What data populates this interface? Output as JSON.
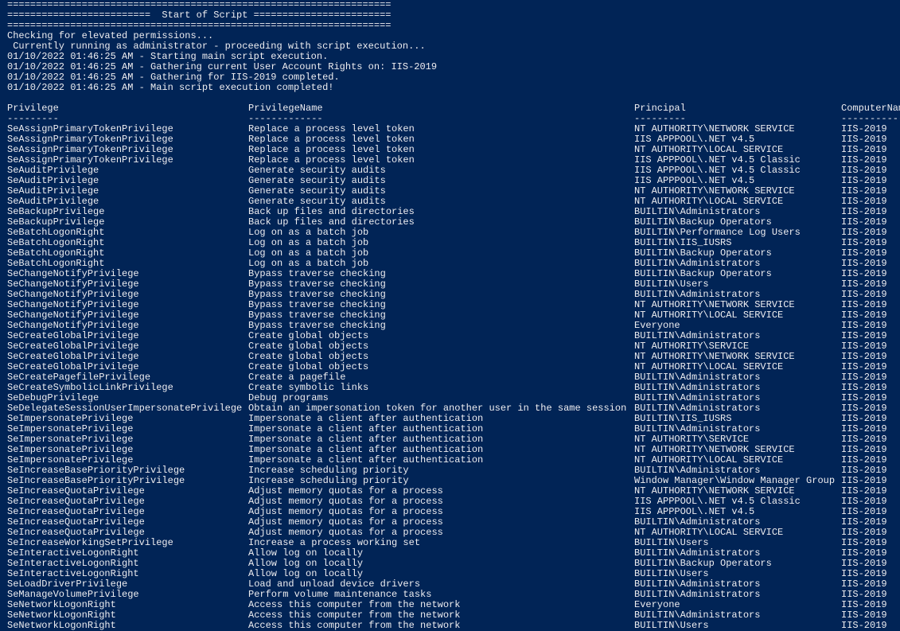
{
  "colors": {
    "background": "#012456",
    "text": "#eeedf0"
  },
  "banner": [
    "===================================================================",
    "=========================  Start of Script ========================",
    "==================================================================="
  ],
  "log": [
    "Checking for elevated permissions...",
    " Currently running as administrator - proceeding with script execution...",
    "01/10/2022 01:46:25 AM - Starting main script execution.",
    "01/10/2022 01:46:25 AM - Gathering current User Account Rights on: IIS-2019",
    "01/10/2022 01:46:25 AM - Gathering for IIS-2019 completed.",
    "01/10/2022 01:46:25 AM - Main script execution completed!"
  ],
  "table": {
    "headers": [
      "Privilege",
      "PrivilegeName",
      "Principal",
      "ComputerName"
    ],
    "underlines": [
      "---------",
      "-------------",
      "---------",
      "------------"
    ],
    "rows": [
      [
        "SeAssignPrimaryTokenPrivilege",
        "Replace a process level token",
        "NT AUTHORITY\\NETWORK SERVICE",
        "IIS-2019"
      ],
      [
        "SeAssignPrimaryTokenPrivilege",
        "Replace a process level token",
        "IIS APPPOOL\\.NET v4.5",
        "IIS-2019"
      ],
      [
        "SeAssignPrimaryTokenPrivilege",
        "Replace a process level token",
        "NT AUTHORITY\\LOCAL SERVICE",
        "IIS-2019"
      ],
      [
        "SeAssignPrimaryTokenPrivilege",
        "Replace a process level token",
        "IIS APPPOOL\\.NET v4.5 Classic",
        "IIS-2019"
      ],
      [
        "SeAuditPrivilege",
        "Generate security audits",
        "IIS APPPOOL\\.NET v4.5 Classic",
        "IIS-2019"
      ],
      [
        "SeAuditPrivilege",
        "Generate security audits",
        "IIS APPPOOL\\.NET v4.5",
        "IIS-2019"
      ],
      [
        "SeAuditPrivilege",
        "Generate security audits",
        "NT AUTHORITY\\NETWORK SERVICE",
        "IIS-2019"
      ],
      [
        "SeAuditPrivilege",
        "Generate security audits",
        "NT AUTHORITY\\LOCAL SERVICE",
        "IIS-2019"
      ],
      [
        "SeBackupPrivilege",
        "Back up files and directories",
        "BUILTIN\\Administrators",
        "IIS-2019"
      ],
      [
        "SeBackupPrivilege",
        "Back up files and directories",
        "BUILTIN\\Backup Operators",
        "IIS-2019"
      ],
      [
        "SeBatchLogonRight",
        "Log on as a batch job",
        "BUILTIN\\Performance Log Users",
        "IIS-2019"
      ],
      [
        "SeBatchLogonRight",
        "Log on as a batch job",
        "BUILTIN\\IIS_IUSRS",
        "IIS-2019"
      ],
      [
        "SeBatchLogonRight",
        "Log on as a batch job",
        "BUILTIN\\Backup Operators",
        "IIS-2019"
      ],
      [
        "SeBatchLogonRight",
        "Log on as a batch job",
        "BUILTIN\\Administrators",
        "IIS-2019"
      ],
      [
        "SeChangeNotifyPrivilege",
        "Bypass traverse checking",
        "BUILTIN\\Backup Operators",
        "IIS-2019"
      ],
      [
        "SeChangeNotifyPrivilege",
        "Bypass traverse checking",
        "BUILTIN\\Users",
        "IIS-2019"
      ],
      [
        "SeChangeNotifyPrivilege",
        "Bypass traverse checking",
        "BUILTIN\\Administrators",
        "IIS-2019"
      ],
      [
        "SeChangeNotifyPrivilege",
        "Bypass traverse checking",
        "NT AUTHORITY\\NETWORK SERVICE",
        "IIS-2019"
      ],
      [
        "SeChangeNotifyPrivilege",
        "Bypass traverse checking",
        "NT AUTHORITY\\LOCAL SERVICE",
        "IIS-2019"
      ],
      [
        "SeChangeNotifyPrivilege",
        "Bypass traverse checking",
        "Everyone",
        "IIS-2019"
      ],
      [
        "SeCreateGlobalPrivilege",
        "Create global objects",
        "BUILTIN\\Administrators",
        "IIS-2019"
      ],
      [
        "SeCreateGlobalPrivilege",
        "Create global objects",
        "NT AUTHORITY\\SERVICE",
        "IIS-2019"
      ],
      [
        "SeCreateGlobalPrivilege",
        "Create global objects",
        "NT AUTHORITY\\NETWORK SERVICE",
        "IIS-2019"
      ],
      [
        "SeCreateGlobalPrivilege",
        "Create global objects",
        "NT AUTHORITY\\LOCAL SERVICE",
        "IIS-2019"
      ],
      [
        "SeCreatePagefilePrivilege",
        "Create a pagefile",
        "BUILTIN\\Administrators",
        "IIS-2019"
      ],
      [
        "SeCreateSymbolicLinkPrivilege",
        "Create symbolic links",
        "BUILTIN\\Administrators",
        "IIS-2019"
      ],
      [
        "SeDebugPrivilege",
        "Debug programs",
        "BUILTIN\\Administrators",
        "IIS-2019"
      ],
      [
        "SeDelegateSessionUserImpersonatePrivilege",
        "Obtain an impersonation token for another user in the same session",
        "BUILTIN\\Administrators",
        "IIS-2019"
      ],
      [
        "SeImpersonatePrivilege",
        "Impersonate a client after authentication",
        "BUILTIN\\IIS_IUSRS",
        "IIS-2019"
      ],
      [
        "SeImpersonatePrivilege",
        "Impersonate a client after authentication",
        "BUILTIN\\Administrators",
        "IIS-2019"
      ],
      [
        "SeImpersonatePrivilege",
        "Impersonate a client after authentication",
        "NT AUTHORITY\\SERVICE",
        "IIS-2019"
      ],
      [
        "SeImpersonatePrivilege",
        "Impersonate a client after authentication",
        "NT AUTHORITY\\NETWORK SERVICE",
        "IIS-2019"
      ],
      [
        "SeImpersonatePrivilege",
        "Impersonate a client after authentication",
        "NT AUTHORITY\\LOCAL SERVICE",
        "IIS-2019"
      ],
      [
        "SeIncreaseBasePriorityPrivilege",
        "Increase scheduling priority",
        "BUILTIN\\Administrators",
        "IIS-2019"
      ],
      [
        "SeIncreaseBasePriorityPrivilege",
        "Increase scheduling priority",
        "Window Manager\\Window Manager Group",
        "IIS-2019"
      ],
      [
        "SeIncreaseQuotaPrivilege",
        "Adjust memory quotas for a process",
        "NT AUTHORITY\\NETWORK SERVICE",
        "IIS-2019"
      ],
      [
        "SeIncreaseQuotaPrivilege",
        "Adjust memory quotas for a process",
        "IIS APPPOOL\\.NET v4.5 Classic",
        "IIS-2019"
      ],
      [
        "SeIncreaseQuotaPrivilege",
        "Adjust memory quotas for a process",
        "IIS APPPOOL\\.NET v4.5",
        "IIS-2019"
      ],
      [
        "SeIncreaseQuotaPrivilege",
        "Adjust memory quotas for a process",
        "BUILTIN\\Administrators",
        "IIS-2019"
      ],
      [
        "SeIncreaseQuotaPrivilege",
        "Adjust memory quotas for a process",
        "NT AUTHORITY\\LOCAL SERVICE",
        "IIS-2019"
      ],
      [
        "SeIncreaseWorkingSetPrivilege",
        "Increase a process working set",
        "BUILTIN\\Users",
        "IIS-2019"
      ],
      [
        "SeInteractiveLogonRight",
        "Allow log on locally",
        "BUILTIN\\Administrators",
        "IIS-2019"
      ],
      [
        "SeInteractiveLogonRight",
        "Allow log on locally",
        "BUILTIN\\Backup Operators",
        "IIS-2019"
      ],
      [
        "SeInteractiveLogonRight",
        "Allow log on locally",
        "BUILTIN\\Users",
        "IIS-2019"
      ],
      [
        "SeLoadDriverPrivilege",
        "Load and unload device drivers",
        "BUILTIN\\Administrators",
        "IIS-2019"
      ],
      [
        "SeManageVolumePrivilege",
        "Perform volume maintenance tasks",
        "BUILTIN\\Administrators",
        "IIS-2019"
      ],
      [
        "SeNetworkLogonRight",
        "Access this computer from the network",
        "Everyone",
        "IIS-2019"
      ],
      [
        "SeNetworkLogonRight",
        "Access this computer from the network",
        "BUILTIN\\Administrators",
        "IIS-2019"
      ],
      [
        "SeNetworkLogonRight",
        "Access this computer from the network",
        "BUILTIN\\Users",
        "IIS-2019"
      ]
    ]
  }
}
